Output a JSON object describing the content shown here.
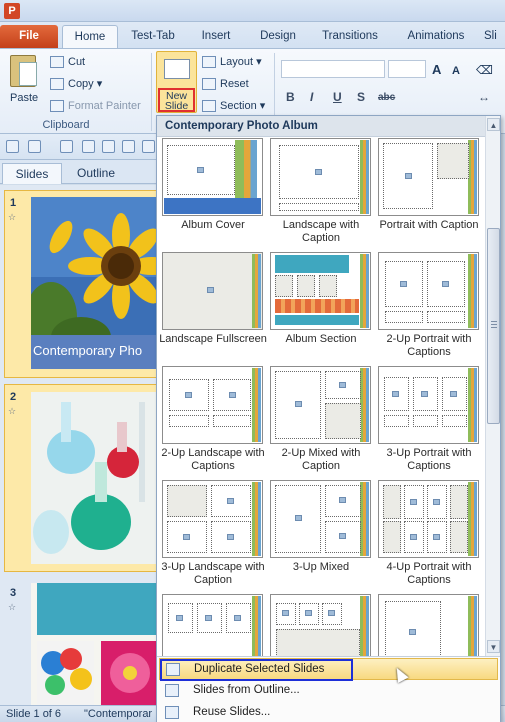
{
  "app_icon": "P",
  "tabs": [
    "File",
    "Home",
    "Test-Tab",
    "Insert",
    "Design",
    "Transitions",
    "Animations",
    "Sli"
  ],
  "active_tab": "Home",
  "ribbon": {
    "clipboard": {
      "paste": "Paste",
      "cut": "Cut",
      "copy": "Copy",
      "format_painter": "Format Painter",
      "label": "Clipboard"
    },
    "slides": {
      "new_slide_line1": "New",
      "new_slide_line2": "Slide",
      "layout": "Layout",
      "reset": "Reset",
      "section": "Section"
    },
    "font": {
      "bold": "B",
      "italic": "I",
      "underline": "U",
      "strike": "S",
      "shadow": "abc",
      "grow": "A",
      "shrink": "A"
    }
  },
  "panel_tabs": [
    "Slides",
    "Outline"
  ],
  "slides": [
    {
      "number": "1",
      "caption": "Contemporary Pho"
    },
    {
      "number": "2"
    },
    {
      "number": "3"
    }
  ],
  "status": {
    "slide": "Slide 1 of 6",
    "theme": "\"Contemporar"
  },
  "gallery": {
    "title": "Contemporary Photo Album",
    "layouts": [
      {
        "name": "Album Cover",
        "icon": "album-cover-layout-icon"
      },
      {
        "name": "Landscape with Caption",
        "icon": "landscape-caption-layout-icon"
      },
      {
        "name": "Portrait with Caption",
        "icon": "portrait-caption-layout-icon"
      },
      {
        "name": "Landscape Fullscreen",
        "icon": "landscape-fullscreen-layout-icon"
      },
      {
        "name": "Album Section",
        "icon": "album-section-layout-icon"
      },
      {
        "name": "2-Up Portrait with Captions",
        "icon": "two-up-portrait-captions-layout-icon"
      },
      {
        "name": "2-Up Landscape with Captions",
        "icon": "two-up-landscape-captions-layout-icon"
      },
      {
        "name": "2-Up Mixed with Caption",
        "icon": "two-up-mixed-caption-layout-icon"
      },
      {
        "name": "3-Up Portrait with Captions",
        "icon": "three-up-portrait-captions-layout-icon"
      },
      {
        "name": "3-Up Landscape with Caption",
        "icon": "three-up-landscape-caption-layout-icon"
      },
      {
        "name": "3-Up Mixed",
        "icon": "three-up-mixed-layout-icon"
      },
      {
        "name": "4-Up Portrait with Captions",
        "icon": "four-up-portrait-captions-layout-icon"
      }
    ]
  },
  "menu": {
    "duplicate": "Duplicate Selected Slides",
    "from_outline": "Slides from Outline...",
    "reuse": "Reuse Slides..."
  },
  "colors": {
    "file_tab": "#c4401a",
    "highlight_border": "#1d2fd8",
    "new_slide_highlight": "#e03030",
    "slide_selection": "#fde9a8"
  }
}
